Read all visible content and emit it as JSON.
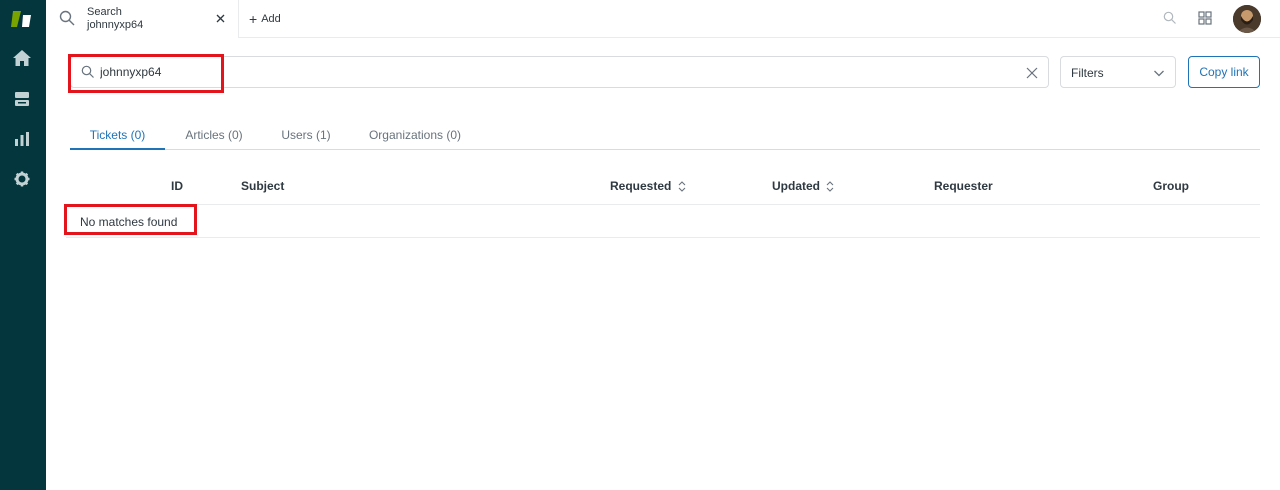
{
  "app": {
    "tab": {
      "title": "Search",
      "subtitle": "johnnyxp64"
    },
    "add_tab_label": "Add"
  },
  "nav": {
    "items": [
      {
        "name": "home",
        "icon": "home-icon"
      },
      {
        "name": "views",
        "icon": "views-icon"
      },
      {
        "name": "reporting",
        "icon": "bar-chart-icon"
      },
      {
        "name": "admin",
        "icon": "gear-icon"
      }
    ]
  },
  "search": {
    "value": "johnnyxp64",
    "placeholder": ""
  },
  "filters": {
    "label": "Filters"
  },
  "copy_link": {
    "label": "Copy link"
  },
  "result_tabs": [
    {
      "label": "Tickets (0)",
      "active": true
    },
    {
      "label": "Articles (0)",
      "active": false
    },
    {
      "label": "Users (1)",
      "active": false
    },
    {
      "label": "Organizations (0)",
      "active": false
    }
  ],
  "table": {
    "columns": [
      "ID",
      "Subject",
      "Requested",
      "Updated",
      "Requester",
      "Group"
    ],
    "empty_message": "No matches found"
  },
  "colors": {
    "nav_bg": "#03363d",
    "accent": "#1f73b7",
    "highlight": "#e3141b",
    "logo": "#78a300"
  }
}
